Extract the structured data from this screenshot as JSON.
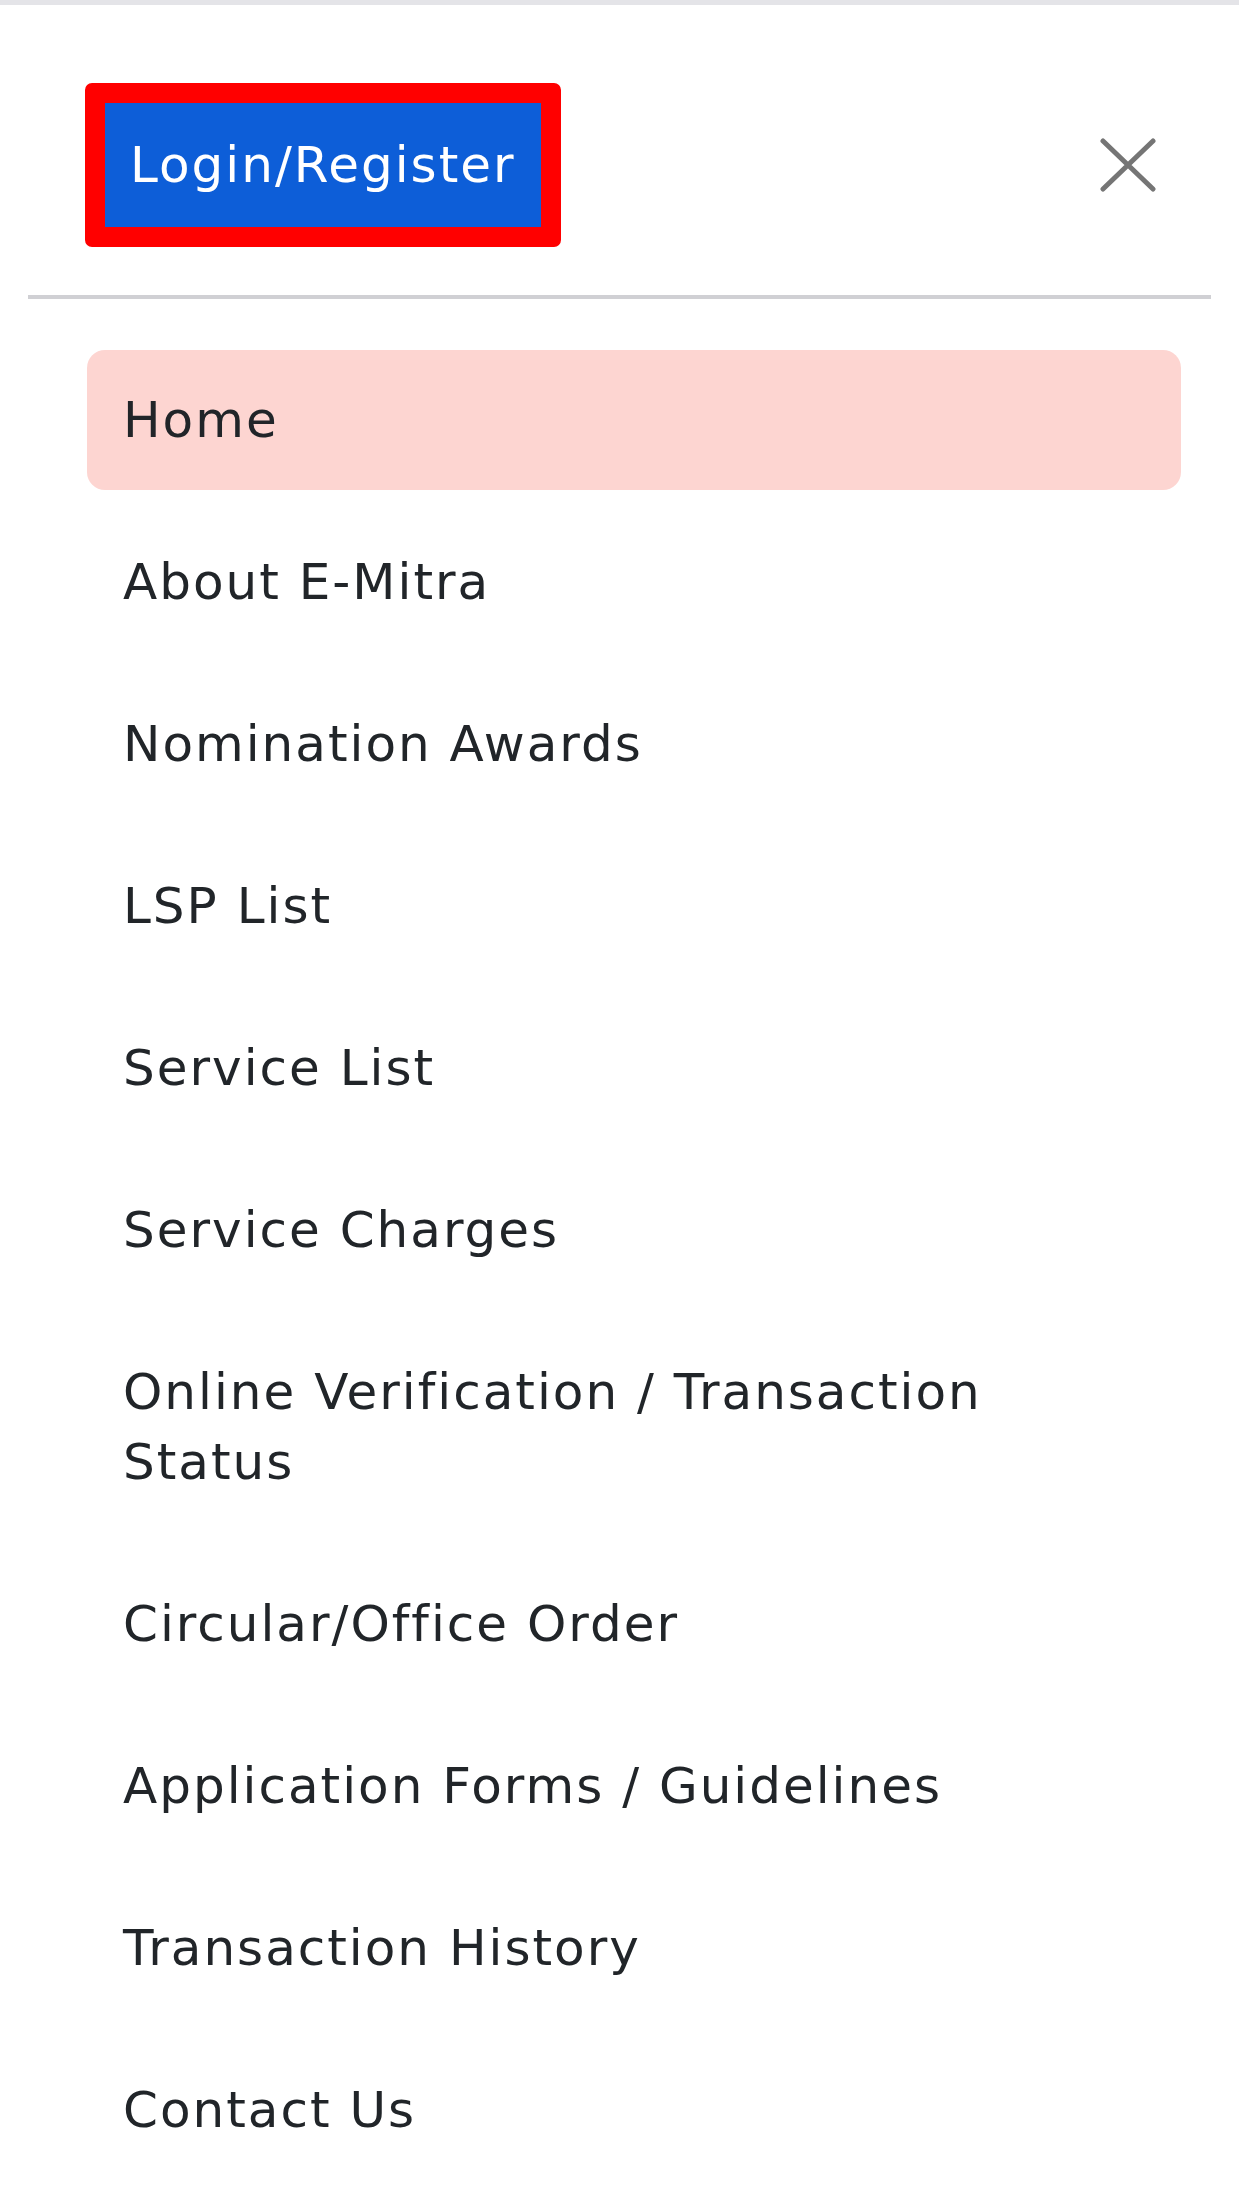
{
  "login_button": {
    "label": "Login/Register",
    "highlighted": true
  },
  "menu": {
    "items": [
      {
        "label": "Home",
        "selected": true
      },
      {
        "label": "About E-Mitra",
        "selected": false
      },
      {
        "label": "Nomination Awards",
        "selected": false
      },
      {
        "label": "LSP List",
        "selected": false
      },
      {
        "label": "Service List",
        "selected": false
      },
      {
        "label": "Service Charges",
        "selected": false
      },
      {
        "label": "Online Verification / Transaction Status",
        "selected": false
      },
      {
        "label": "Circular/Office Order",
        "selected": false
      },
      {
        "label": "Application Forms / Guidelines",
        "selected": false
      },
      {
        "label": "Transaction History",
        "selected": false
      },
      {
        "label": "Contact Us",
        "selected": false
      }
    ]
  }
}
